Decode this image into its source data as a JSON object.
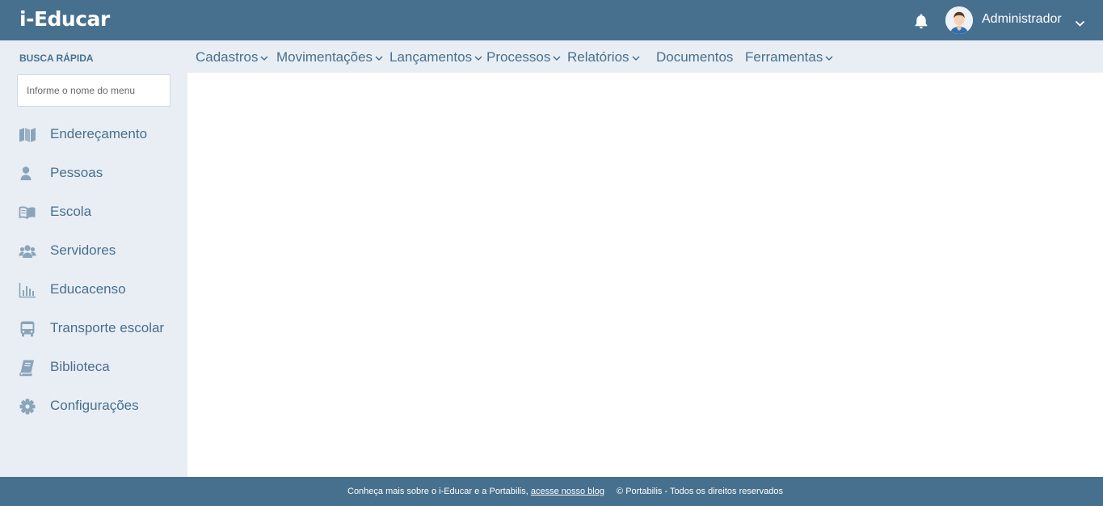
{
  "header": {
    "logo": "i-Educar",
    "user_name": "Administrador",
    "icons": {
      "notifications": "bell-icon",
      "user_menu": "chevron-down-icon"
    }
  },
  "search": {
    "label": "BUSCA RÁPIDA",
    "placeholder": "Informe o nome do menu"
  },
  "sidebar": {
    "items": [
      {
        "label": "Endereçamento",
        "icon": "map-icon"
      },
      {
        "label": "Pessoas",
        "icon": "person-icon"
      },
      {
        "label": "Escola",
        "icon": "open-book-icon"
      },
      {
        "label": "Servidores",
        "icon": "users-icon"
      },
      {
        "label": "Educacenso",
        "icon": "bar-chart-icon"
      },
      {
        "label": "Transporte escolar",
        "icon": "bus-icon"
      },
      {
        "label": "Biblioteca",
        "icon": "book-icon"
      },
      {
        "label": "Configurações",
        "icon": "gear-icon"
      }
    ]
  },
  "menu": {
    "items": [
      {
        "label": "Cadastros"
      },
      {
        "label": "Movimentações"
      },
      {
        "label": "Lançamentos"
      },
      {
        "label": "Processos"
      },
      {
        "label": "Relatórios"
      },
      {
        "label": "Documentos"
      },
      {
        "label": "Ferramentas"
      }
    ]
  },
  "footer": {
    "text": "Conheça mais sobre o i-Educar e a Portabilis,",
    "link": "acesse nosso blog",
    "copyright": "© Portabilis - Todos os direitos reservados"
  },
  "colors": {
    "primary": "#47708f",
    "sidebar_bg": "#e9eef5",
    "icon": "#8aa4ba",
    "content_bg": "#ffffff"
  }
}
